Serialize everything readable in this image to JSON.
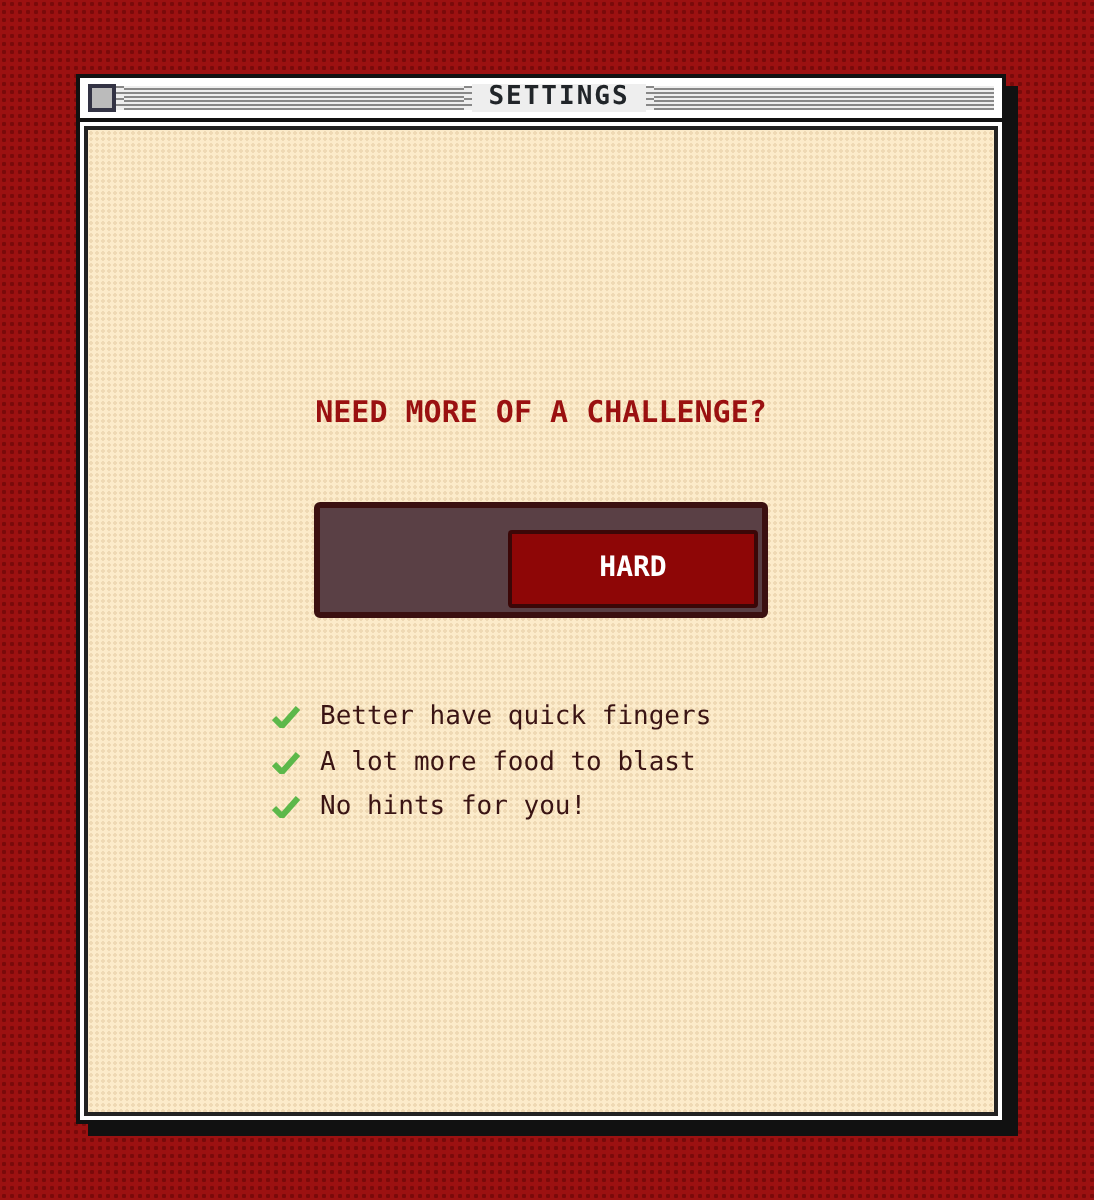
{
  "window": {
    "title": "SETTINGS"
  },
  "heading": "NEED MORE OF A CHALLENGE?",
  "toggle": {
    "label": "HARD",
    "on": true
  },
  "features": [
    {
      "text": "Better have quick fingers",
      "checked": true
    },
    {
      "text": "A lot more food to blast",
      "checked": true
    },
    {
      "text": "No hints for you!",
      "checked": true
    }
  ]
}
